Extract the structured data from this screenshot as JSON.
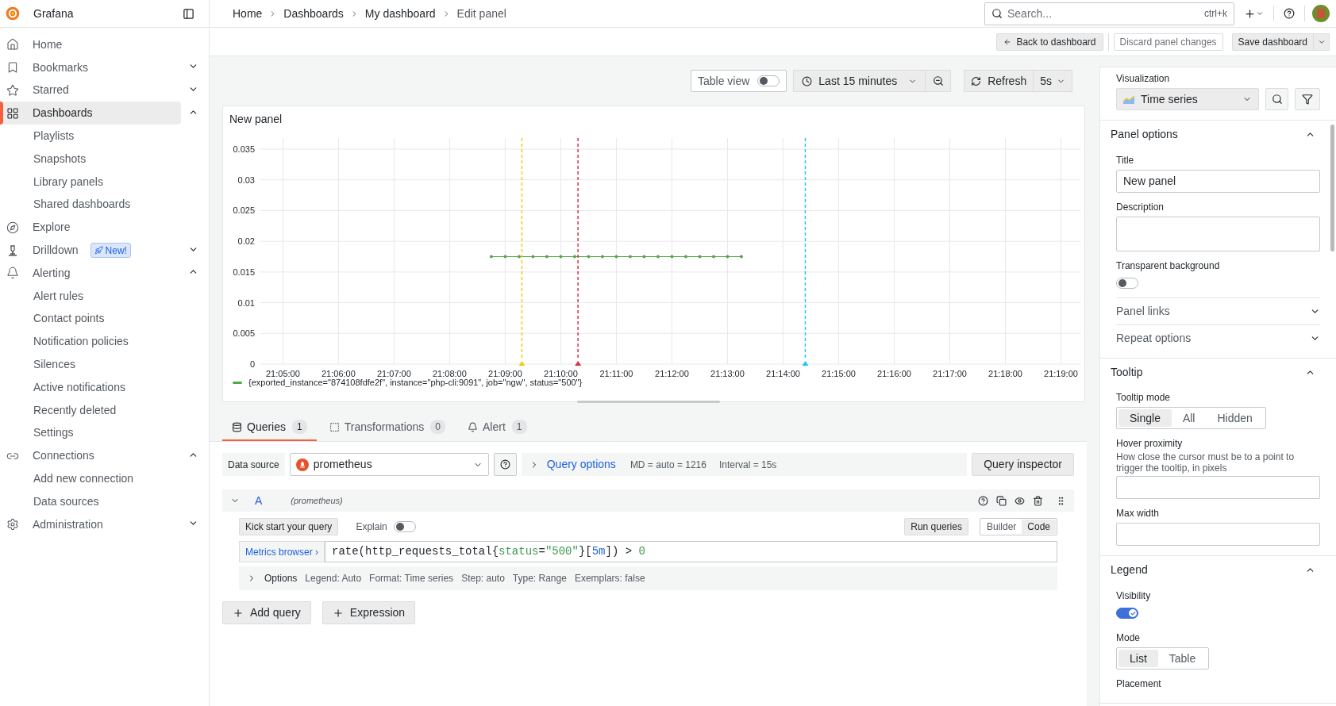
{
  "sidebar": {
    "brand": "Grafana",
    "items": [
      {
        "label": "Home",
        "selected": false
      },
      {
        "label": "Bookmarks",
        "selected": false,
        "expanded": false
      },
      {
        "label": "Starred",
        "selected": false,
        "expanded": false
      },
      {
        "label": "Dashboards",
        "selected": true,
        "expanded": true,
        "children": [
          {
            "label": "Playlists",
            "selected": false
          },
          {
            "label": "Snapshots",
            "selected": false
          },
          {
            "label": "Library panels",
            "selected": false
          },
          {
            "label": "Shared dashboards",
            "selected": false
          }
        ]
      },
      {
        "label": "Explore",
        "selected": false
      },
      {
        "label": "Drilldown",
        "selected": false,
        "expanded": false,
        "badge": "New!"
      },
      {
        "label": "Alerting",
        "selected": false,
        "expanded": true,
        "children": [
          {
            "label": "Alert rules",
            "selected": false
          },
          {
            "label": "Contact points",
            "selected": false
          },
          {
            "label": "Notification policies",
            "selected": false
          },
          {
            "label": "Silences",
            "selected": false
          },
          {
            "label": "Active notifications",
            "selected": false
          },
          {
            "label": "Recently deleted",
            "selected": false
          },
          {
            "label": "Settings",
            "selected": false
          }
        ]
      },
      {
        "label": "Connections",
        "selected": false,
        "expanded": true,
        "children": [
          {
            "label": "Add new connection",
            "selected": false
          },
          {
            "label": "Data sources",
            "selected": false
          }
        ]
      },
      {
        "label": "Administration",
        "selected": false,
        "expanded": false
      }
    ]
  },
  "breadcrumbs": [
    "Home",
    "Dashboards",
    "My dashboard",
    "Edit panel"
  ],
  "search": {
    "placeholder": "Search...",
    "shortcut": "ctrl+k"
  },
  "toolbar": {
    "back": "Back to dashboard",
    "discard": "Discard panel changes",
    "save": "Save dashboard"
  },
  "time_controls": {
    "table_view": {
      "label": "Table view",
      "on": false
    },
    "range": "Last 15 minutes",
    "refresh": "Refresh",
    "interval": "5s"
  },
  "panel": {
    "title": "New panel",
    "annotation_markers": [
      {
        "color": "#f2cc0c"
      },
      {
        "color": "#e02f44"
      },
      {
        "color": "#1fc8f0"
      }
    ],
    "chart_data": {
      "type": "line",
      "categories": [
        null,
        "21:05:00",
        null,
        null,
        null,
        "21:06:00",
        null,
        null,
        null,
        "21:07:00",
        null,
        null,
        null,
        "21:08:00",
        null,
        null,
        null,
        "21:09:00",
        null,
        null,
        null,
        "21:10:00",
        null,
        null,
        null,
        "21:11:00",
        null,
        null,
        null,
        "21:12:00",
        null,
        null,
        null,
        "21:13:00",
        null,
        null,
        null,
        "21:14:00",
        null,
        null,
        null,
        "21:15:00",
        null,
        null,
        null,
        "21:16:00",
        null,
        null,
        null,
        "21:17:00",
        null,
        null,
        null,
        "21:18:00",
        null,
        null,
        null,
        "21:19:00",
        null
      ],
      "series": [
        {
          "name": "{exported_instance=\"874108fdfe2f\", instance=\"php-cli:9091\", job=\"ngw\", status=\"500\"}",
          "color": "#56a64b",
          "values": [
            null,
            null,
            null,
            null,
            null,
            null,
            null,
            null,
            null,
            null,
            null,
            null,
            null,
            null,
            null,
            null,
            0.0175,
            0.0175,
            0.0175,
            0.0175,
            0.0175,
            0.0175,
            0.0175,
            0.0175,
            0.0175,
            0.0175,
            0.0175,
            0.0175,
            0.0175,
            0.0175,
            0.0175,
            0.0175,
            0.0175,
            0.0175,
            0.0175,
            null,
            null,
            null,
            null,
            null,
            null,
            null,
            null,
            null,
            null,
            null,
            null,
            null,
            null,
            null,
            null,
            null,
            null,
            null,
            null,
            null,
            null,
            null,
            null
          ]
        }
      ],
      "ylim": [
        0,
        0.035
      ],
      "grid": true,
      "yticks": [
        {
          "value": 0,
          "label": "0"
        },
        {
          "value": 0.005,
          "label": "0.005"
        },
        {
          "value": 0.01,
          "label": "0.01"
        },
        {
          "value": 0.015,
          "label": "0.015"
        },
        {
          "value": 0.02,
          "label": "0.02"
        },
        {
          "value": 0.025,
          "label": "0.025"
        },
        {
          "value": 0.03,
          "label": "0.03"
        },
        {
          "value": 0.035,
          "label": "0.035"
        }
      ]
    }
  },
  "tabs": [
    {
      "label": "Queries",
      "count": "1",
      "selected": true
    },
    {
      "label": "Transformations",
      "count": "0",
      "selected": false
    },
    {
      "label": "Alert",
      "count": "1",
      "selected": false
    }
  ],
  "datasource": {
    "label": "Data source",
    "value": "prometheus",
    "query_options": "Query options",
    "md": "MD = auto = 1216",
    "interval": "Interval = 15s",
    "inspector": "Query inspector"
  },
  "query": {
    "ref": "A",
    "source": "(prometheus)",
    "expanded": true,
    "kick_start": "Kick start your query",
    "explain": {
      "label": "Explain",
      "on": false
    },
    "run": "Run queries",
    "modes": [
      {
        "label": "Builder",
        "selected": false
      },
      {
        "label": "Code",
        "selected": true
      }
    ],
    "metrics_browser": "Metrics browser ›",
    "expr": [
      {
        "text": "rate(http_requests_total{",
        "kind": "plain"
      },
      {
        "text": "status",
        "kind": "label"
      },
      {
        "text": "=",
        "kind": "plain"
      },
      {
        "text": "\"500\"",
        "kind": "string"
      },
      {
        "text": "}[",
        "kind": "plain"
      },
      {
        "text": "5m",
        "kind": "duration"
      },
      {
        "text": "]) > ",
        "kind": "plain"
      },
      {
        "text": "0",
        "kind": "number"
      }
    ],
    "options_label": "Options",
    "options": [
      "Legend: Auto",
      "Format: Time series",
      "Step: auto",
      "Type: Range",
      "Exemplars: false"
    ]
  },
  "add_buttons": [
    "Add query",
    "Expression"
  ],
  "options_pane": {
    "visualization_label": "Visualization",
    "visualization": "Time series",
    "sections": [
      {
        "title": "Panel options",
        "expanded": true,
        "items": [
          {
            "kind": "input",
            "label": "Title",
            "value": "New panel"
          },
          {
            "kind": "textarea",
            "label": "Description"
          },
          {
            "kind": "toggle",
            "label": "Transparent background",
            "on": false
          },
          {
            "kind": "group",
            "label": "Panel links",
            "expanded": false
          },
          {
            "kind": "group",
            "label": "Repeat options",
            "expanded": false
          }
        ]
      },
      {
        "title": "Tooltip",
        "expanded": true,
        "items": [
          {
            "kind": "radio",
            "label": "Tooltip mode",
            "options": [
              {
                "label": "Single",
                "selected": true
              },
              {
                "label": "All",
                "selected": false
              },
              {
                "label": "Hidden",
                "selected": false
              }
            ]
          },
          {
            "kind": "input",
            "label": "Hover proximity",
            "description": "How close the cursor must be to a point to trigger the tooltip, in pixels"
          },
          {
            "kind": "input",
            "label": "Max width"
          }
        ]
      },
      {
        "title": "Legend",
        "expanded": true,
        "items": [
          {
            "kind": "toggle",
            "label": "Visibility",
            "on": true
          },
          {
            "kind": "radio",
            "label": "Mode",
            "options": [
              {
                "label": "List",
                "selected": true
              },
              {
                "label": "Table",
                "selected": false
              }
            ]
          },
          {
            "kind": "label",
            "label": "Placement"
          }
        ]
      }
    ]
  }
}
